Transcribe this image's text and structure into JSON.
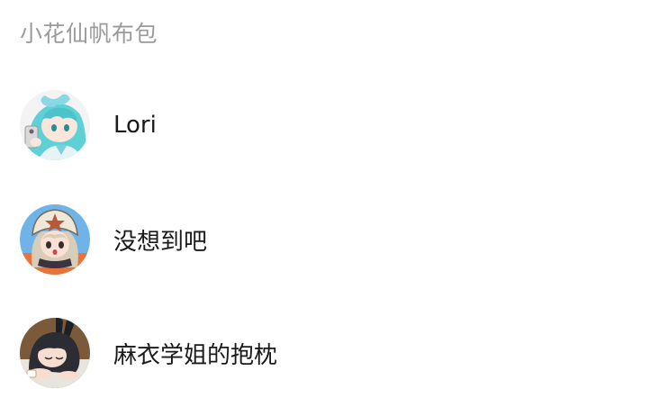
{
  "section": {
    "title": "小花仙帆布包"
  },
  "contacts": [
    {
      "name": "Lori",
      "avatar_icon": "avatar-anime-teal-hair",
      "colors": {
        "bg": "#f4f4f4",
        "hair": "#5fd0d6",
        "accent": "#8ad7e6",
        "skin": "#fbe6dc"
      }
    },
    {
      "name": "没想到吧",
      "avatar_icon": "avatar-anime-helmet",
      "colors": {
        "bg": "#6fb3e8",
        "hair": "#d8cdb8",
        "accent": "#7a6a55",
        "skin": "#fbe1d3"
      }
    },
    {
      "name": "麻衣学姐的抱枕",
      "avatar_icon": "avatar-anime-bunny-girl",
      "colors": {
        "bg": "#7a5a3a",
        "hair": "#2c2c34",
        "accent": "#c9a27a",
        "skin": "#f6ddd0"
      }
    }
  ]
}
